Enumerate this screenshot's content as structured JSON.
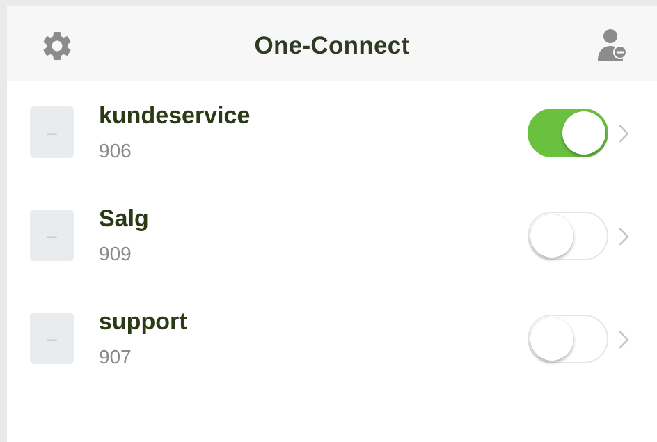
{
  "navbar": {
    "title": "One-Connect",
    "left_icon": "gear-icon",
    "right_icon": "user-remove-icon"
  },
  "queues": [
    {
      "name": "kundeservice",
      "number": "906",
      "enabled": true,
      "placeholder_glyph": "–"
    },
    {
      "name": "Salg",
      "number": "909",
      "enabled": false,
      "placeholder_glyph": "–"
    },
    {
      "name": "support",
      "number": "907",
      "enabled": false,
      "placeholder_glyph": "–"
    }
  ],
  "colors": {
    "toggle_on": "#6ac140",
    "title_text": "#2a3a14",
    "subtitle_text": "#8a8a8a",
    "icon_gray": "#8c8c8c"
  }
}
